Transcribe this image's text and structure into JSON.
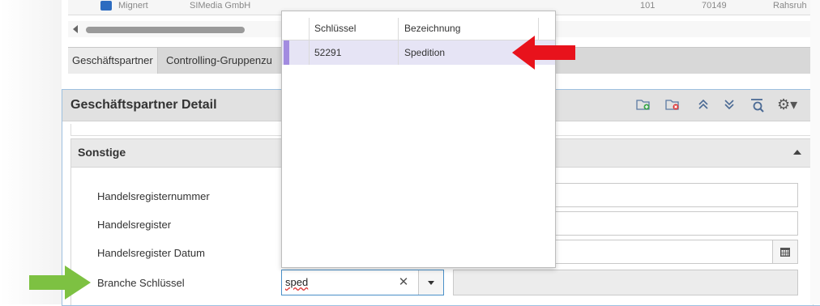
{
  "top_table": {
    "cells": [
      "Mignert",
      "SIMedia GmbH",
      "101",
      "70149",
      "Rahsruh"
    ]
  },
  "tabs": [
    {
      "label": "Geschäftspartner",
      "active": true
    },
    {
      "label": "Controlling-Gruppenzu",
      "active": false
    }
  ],
  "panel": {
    "title": "Geschäftspartner Detail",
    "toolbar_icons": [
      "add-folder-icon",
      "delete-folder-icon",
      "collapse-all-icon",
      "expand-all-icon",
      "search-icon",
      "gear-icon"
    ]
  },
  "section": {
    "title": "Sonstige"
  },
  "fields": [
    {
      "label": "Handelsregisternummer",
      "value": ""
    },
    {
      "label": "Handelsregister",
      "value": ""
    },
    {
      "label": "Handelsregister Datum",
      "value": ""
    },
    {
      "label": "Branche Schlüssel",
      "value": "sped"
    }
  ],
  "dropdown": {
    "columns": [
      "Schlüssel",
      "Bezeichnung"
    ],
    "rows": [
      {
        "key": "52291",
        "name": "Spedition"
      }
    ]
  },
  "colors": {
    "highlight_row": "#e6e4f5",
    "arrow_red": "#e8121c",
    "arrow_green": "#7dc142"
  }
}
